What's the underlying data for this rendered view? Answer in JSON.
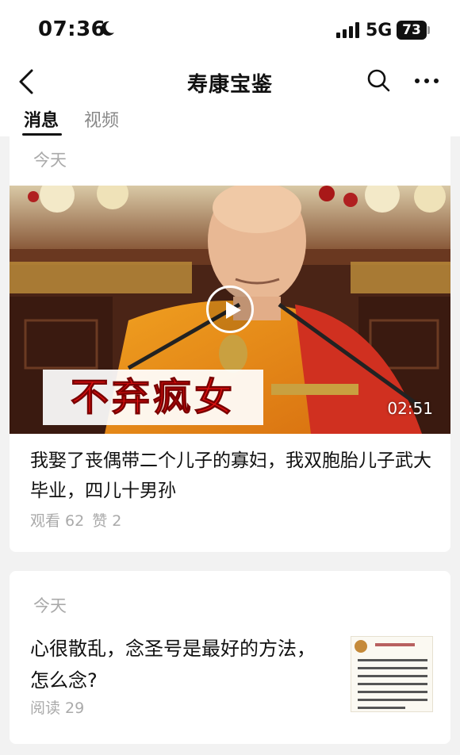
{
  "status_bar": {
    "time": "07:36",
    "network": "5G",
    "battery": "73"
  },
  "nav": {
    "title": "寿康宝鉴"
  },
  "tabs": [
    {
      "label": "消息",
      "active": true
    },
    {
      "label": "视频",
      "active": false
    }
  ],
  "posts": [
    {
      "date": "今天",
      "type": "video",
      "video_caption": "不弃疯女",
      "duration": "02:51",
      "title": "我娶了丧偶带二个儿子的寡妇，我双胞胎儿子武大毕业，四儿十男孙",
      "views": "观看 62",
      "likes": "赞 2"
    },
    {
      "date": "今天",
      "type": "article",
      "title": "心很散乱，念圣号是最好的方法，怎么念?",
      "reads": "阅读 29"
    }
  ],
  "colors": {
    "accent_text": "#111111",
    "meta_gray": "#aaaaaa",
    "page_bg": "#f2f2f2",
    "caption_red": "#e01010"
  },
  "icons": [
    "moon-icon",
    "signal-icon",
    "back-icon",
    "search-icon",
    "more-icon",
    "play-icon"
  ]
}
